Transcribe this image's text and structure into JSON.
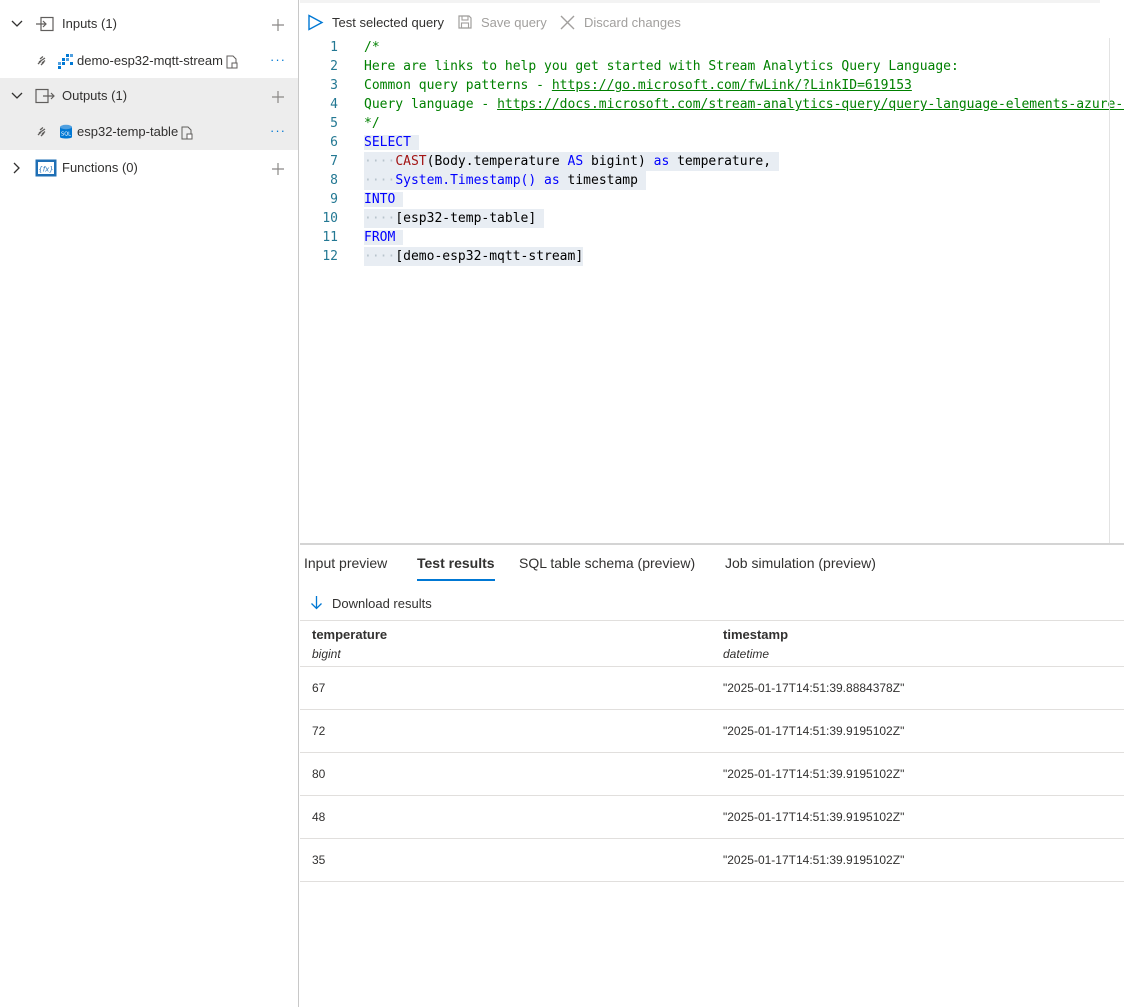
{
  "sidebar": {
    "inputs": {
      "label": "Inputs (1)",
      "items": [
        {
          "name": "demo-esp32-mqtt-stream"
        }
      ]
    },
    "outputs": {
      "label": "Outputs (1)",
      "items": [
        {
          "name": "esp32-temp-table",
          "icon_text": "SQL"
        }
      ]
    },
    "functions": {
      "label": "Functions (0)",
      "icon_text": "{fx}"
    },
    "more": "···"
  },
  "toolbar": {
    "test_label": "Test selected query",
    "save_label": "Save query",
    "discard_label": "Discard changes"
  },
  "editor": {
    "line_numbers": [
      "1",
      "2",
      "3",
      "4",
      "5",
      "6",
      "7",
      "8",
      "9",
      "10",
      "11",
      "12"
    ],
    "l1": "/*",
    "l2": "Here are links to help you get started with Stream Analytics Query Language:",
    "l3_prefix": "Common query patterns - ",
    "l3_link": "https://go.microsoft.com/fwLink/?LinkID=619153",
    "l4_prefix": "Query language - ",
    "l4_link": "https://docs.microsoft.com/stream-analytics-query/query-language-elements-azure-stream-analytics",
    "l5": "*/",
    "kw_select": "SELECT",
    "fn_cast": "CAST",
    "l7_arg": "(Body.temperature ",
    "kw_as_upper": "AS",
    "l7_type": " bigint) ",
    "kw_as": "as",
    "l7_alias": " temperature,",
    "l8_fn": "System.Timestamp()",
    "l8_alias": " timestamp",
    "kw_into": "INTO",
    "l10": "[esp32-temp-table]",
    "kw_from": "FROM",
    "l12": "[demo-esp32-mqtt-stream]",
    "indent": "····"
  },
  "tabs": [
    {
      "label": "Input preview",
      "active": false
    },
    {
      "label": "Test results",
      "active": true
    },
    {
      "label": "SQL table schema (preview)",
      "active": false
    },
    {
      "label": "Job simulation (preview)",
      "active": false
    }
  ],
  "download_label": "Download results",
  "results": {
    "columns": [
      {
        "name": "temperature",
        "type": "bigint"
      },
      {
        "name": "timestamp",
        "type": "datetime"
      }
    ],
    "rows": [
      {
        "temperature": "67",
        "timestamp": "\"2025-01-17T14:51:39.8884378Z\""
      },
      {
        "temperature": "72",
        "timestamp": "\"2025-01-17T14:51:39.9195102Z\""
      },
      {
        "temperature": "80",
        "timestamp": "\"2025-01-17T14:51:39.9195102Z\""
      },
      {
        "temperature": "48",
        "timestamp": "\"2025-01-17T14:51:39.9195102Z\""
      },
      {
        "temperature": "35",
        "timestamp": "\"2025-01-17T14:51:39.9195102Z\""
      }
    ]
  },
  "colors": {
    "accent": "#0078d4",
    "comment": "#008000",
    "keyword": "#0000ff",
    "function": "#a31515",
    "line_number": "#237893",
    "selection": "#e8edf3"
  }
}
